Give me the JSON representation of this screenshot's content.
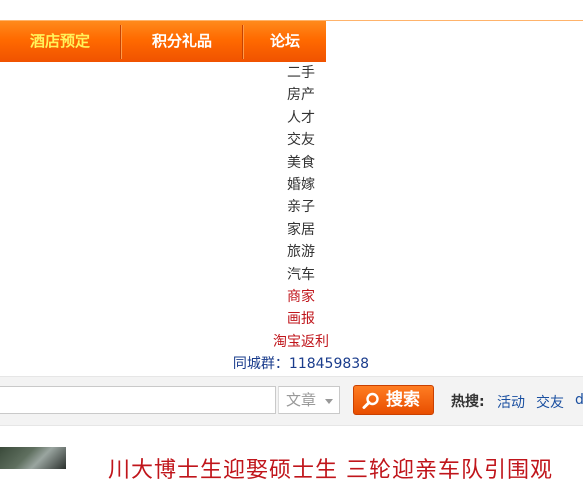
{
  "nav": {
    "items": [
      {
        "label": "酒店预定",
        "active": true
      },
      {
        "label": "积分礼品",
        "active": false
      },
      {
        "label": "论坛",
        "active": false
      }
    ]
  },
  "dropdown": {
    "items": [
      "二手",
      "房产",
      "人才",
      "交友",
      "美食",
      "婚嫁",
      "亲子",
      "家居",
      "旅游",
      "汽车"
    ],
    "highlight_items": [
      "商家",
      "画报",
      "淘宝返利"
    ],
    "group_label": "同城群：",
    "group_number": "118459838"
  },
  "search": {
    "type_label": "文章",
    "button_label": "搜索",
    "hot_label": "热搜:",
    "hot_items": [
      "活动",
      "交友",
      "d"
    ]
  },
  "article": {
    "headline": "川大博士生迎娶硕士生 三轮迎亲车队引围观"
  },
  "colors": {
    "nav_orange": "#ff6a00",
    "active_yellow": "#fff35a",
    "highlight_red": "#c0151b",
    "link_blue": "#1a4fa0"
  }
}
